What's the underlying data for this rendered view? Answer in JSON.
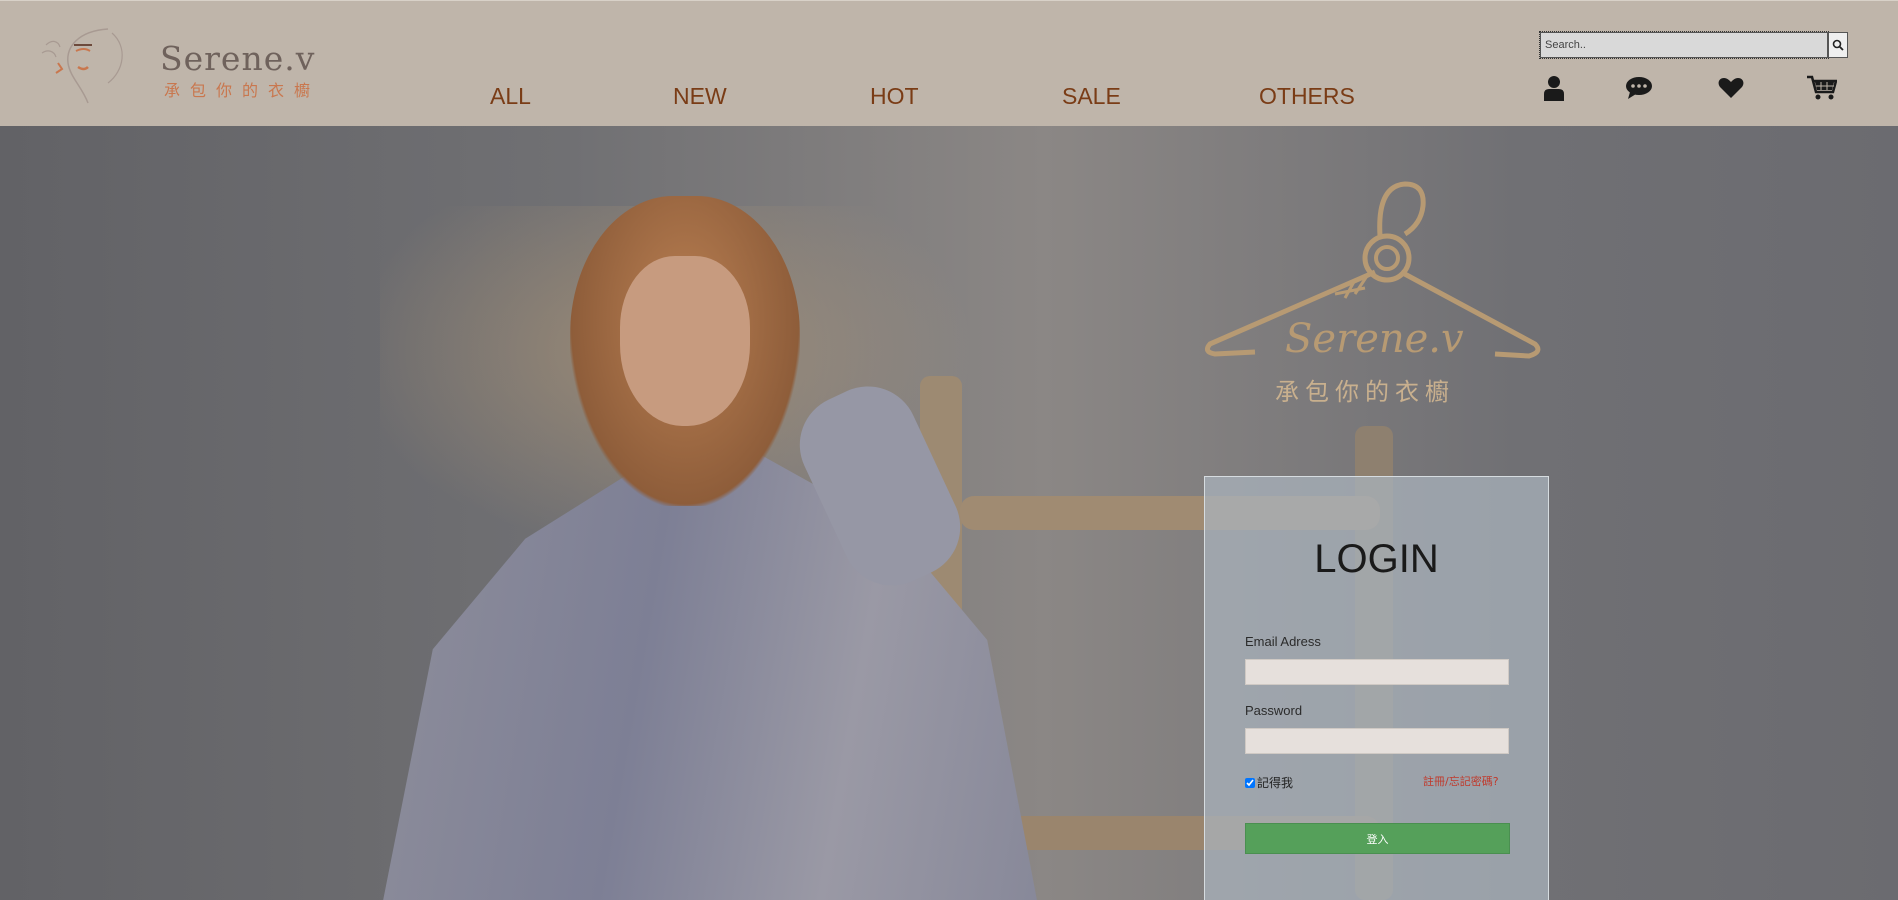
{
  "header": {
    "logo": {
      "name": "Serene.v",
      "tagline": "承包你的衣櫥"
    },
    "nav": [
      {
        "label": "ALL"
      },
      {
        "label": "NEW"
      },
      {
        "label": "HOT"
      },
      {
        "label": "SALE"
      },
      {
        "label": "OTHERS"
      }
    ],
    "search": {
      "placeholder": "Search.."
    },
    "icons": [
      "user-icon",
      "chat-icon",
      "heart-icon",
      "cart-icon",
      "search-icon"
    ]
  },
  "hero": {
    "brand_mark": {
      "name": "Serene.v",
      "tagline": "承包你的衣櫥"
    }
  },
  "login": {
    "title": "LOGIN",
    "email_label": "Email Adress",
    "email_value": "",
    "password_label": "Password",
    "password_value": "",
    "remember_label": "記得我",
    "remember_checked": true,
    "forgot_label": "註冊/忘記密碼?",
    "submit_label": "登入"
  },
  "colors": {
    "header_bg": "#bfb5aa",
    "nav_text": "#7a3c16",
    "login_button": "#55a05a",
    "forgot_link": "#c0392b",
    "brand_gold": "#b79a73"
  }
}
